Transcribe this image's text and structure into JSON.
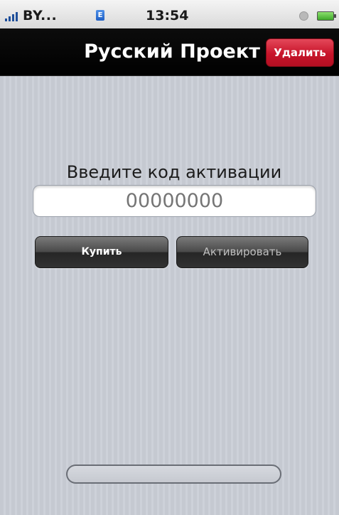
{
  "status_bar": {
    "carrier": "BY...",
    "time": "13:54",
    "data_icon_letter": "E",
    "icons": [
      "signal-strength-icon",
      "data-network-icon",
      "lock-rotation-icon",
      "battery-icon"
    ]
  },
  "nav_bar": {
    "title": "Русский Проект",
    "delete_label": "Удалить",
    "delete_color": "#c8142a"
  },
  "activation": {
    "prompt": "Введите код активации",
    "code_placeholder": "00000000",
    "buy_label": "Купить",
    "activate_label": "Активировать"
  },
  "progress": {
    "value": 0
  },
  "colors": {
    "nav_background": "#000000",
    "content_background": "#c7cbd3",
    "button_dark": "#333333"
  }
}
